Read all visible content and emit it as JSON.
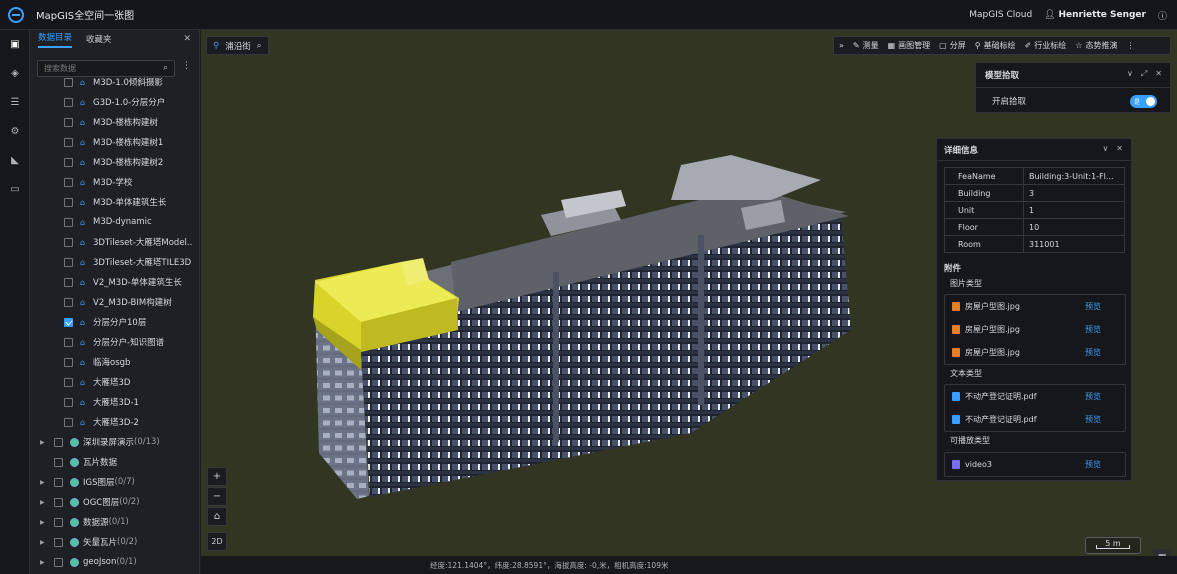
{
  "header": {
    "app_title": "MapGIS全空间一张图",
    "cloud_label": "MapGIS Cloud",
    "user_name": "Henriette Senger"
  },
  "icon_bar": [
    "cube-icon",
    "layers-icon",
    "list-icon",
    "analysis-icon",
    "measure-icon",
    "monitor-icon"
  ],
  "panel": {
    "tabs": [
      {
        "label": "数据目录",
        "active": true
      },
      {
        "label": "收藏夹",
        "active": false
      }
    ],
    "search_placeholder": "搜索数据",
    "tree_items": [
      {
        "label": "M3D-1.0倾斜摄影",
        "checked": false,
        "level": "sub",
        "icon": "building"
      },
      {
        "label": "G3D-1.0-分层分户",
        "checked": false,
        "level": "sub",
        "icon": "building"
      },
      {
        "label": "M3D-楼栋构建树",
        "checked": false,
        "level": "sub",
        "icon": "building"
      },
      {
        "label": "M3D-楼栋构建树1",
        "checked": false,
        "level": "sub",
        "icon": "building"
      },
      {
        "label": "M3D-楼栋构建树2",
        "checked": false,
        "level": "sub",
        "icon": "building"
      },
      {
        "label": "M3D-学校",
        "checked": false,
        "level": "sub",
        "icon": "building"
      },
      {
        "label": "M3D-单体建筑生长",
        "checked": false,
        "level": "sub",
        "icon": "building"
      },
      {
        "label": "M3D-dynamic",
        "checked": false,
        "level": "sub",
        "icon": "building"
      },
      {
        "label": "3DTileset-大雁塔Model...",
        "checked": false,
        "level": "sub",
        "icon": "building"
      },
      {
        "label": "3DTileset-大雁塔TILE3D",
        "checked": false,
        "level": "sub",
        "icon": "building"
      },
      {
        "label": "V2_M3D-单体建筑生长",
        "checked": false,
        "level": "sub",
        "icon": "building"
      },
      {
        "label": "V2_M3D-BIM构建树",
        "checked": false,
        "level": "sub",
        "icon": "building"
      },
      {
        "label": "分层分户10层",
        "checked": true,
        "level": "sub",
        "icon": "building"
      },
      {
        "label": "分层分户-知识图谱",
        "checked": false,
        "level": "sub",
        "icon": "building"
      },
      {
        "label": "临海osgb",
        "checked": false,
        "level": "sub",
        "icon": "building"
      },
      {
        "label": "大雁塔3D",
        "checked": false,
        "level": "sub",
        "icon": "building"
      },
      {
        "label": "大雁塔3D-1",
        "checked": false,
        "level": "sub",
        "icon": "building"
      },
      {
        "label": "大雁塔3D-2",
        "checked": false,
        "level": "sub",
        "icon": "building"
      },
      {
        "label": "深圳录屏演示",
        "count": "(0/13)",
        "checked": false,
        "level": "top",
        "icon": "globe",
        "arrow": true
      },
      {
        "label": "瓦片数据",
        "checked": false,
        "level": "top",
        "icon": "globe",
        "arrow": false
      },
      {
        "label": "IGS图层",
        "count": "(0/7)",
        "checked": false,
        "level": "top",
        "icon": "globe",
        "arrow": true
      },
      {
        "label": "OGC图层",
        "count": "(0/2)",
        "checked": false,
        "level": "top",
        "icon": "globe",
        "arrow": true
      },
      {
        "label": "数据源",
        "count": "(0/1)",
        "checked": false,
        "level": "top",
        "icon": "globe",
        "arrow": true
      },
      {
        "label": "矢量瓦片",
        "count": "(0/2)",
        "checked": false,
        "level": "top",
        "icon": "globe",
        "arrow": true
      },
      {
        "label": "geoJson",
        "count": "(0/1)",
        "checked": false,
        "level": "top",
        "icon": "globe",
        "arrow": true
      }
    ]
  },
  "viewtag": {
    "label": "浦沿街"
  },
  "toolbar": [
    {
      "label": "测量",
      "icon": "ruler-icon"
    },
    {
      "label": "画图管理",
      "icon": "grid-icon"
    },
    {
      "label": "分屏",
      "icon": "split-icon"
    },
    {
      "label": "基础标绘",
      "icon": "pin-icon"
    },
    {
      "label": "行业标绘",
      "icon": "pen-icon"
    },
    {
      "label": "态势推演",
      "icon": "star-icon"
    }
  ],
  "model_pick": {
    "title": "模型拾取",
    "toggle_label": "开启拾取",
    "toggle_on": true,
    "toggle_text": "是"
  },
  "detail": {
    "title": "详细信息",
    "attributes": [
      {
        "key": "FeaName",
        "value": "Building:3-Unit:1-Fl..."
      },
      {
        "key": "Building",
        "value": "3"
      },
      {
        "key": "Unit",
        "value": "1"
      },
      {
        "key": "Floor",
        "value": "10"
      },
      {
        "key": "Room",
        "value": "311001"
      }
    ],
    "attachments_label": "附件",
    "image_type_label": "图片类型",
    "images": [
      {
        "name": "房屋户型图.jpg",
        "action": "预览"
      },
      {
        "name": "房屋户型图.jpg",
        "action": "预览"
      },
      {
        "name": "房屋户型图.jpg",
        "action": "预览"
      }
    ],
    "text_type_label": "文本类型",
    "texts": [
      {
        "name": "不动产登记证明.pdf",
        "action": "预览"
      },
      {
        "name": "不动产登记证明.pdf",
        "action": "预览"
      }
    ],
    "video_type_label": "可播放类型",
    "videos": [
      {
        "name": "video3",
        "action": "预览"
      }
    ]
  },
  "map_controls": {
    "zoom_in": "+",
    "zoom_out": "−",
    "home": "⌂",
    "mode": "2D"
  },
  "scale": "5 m",
  "status": "经度:121.1404°，纬度:28.8591°，海拔高度: -0,米，相机高度:109米"
}
